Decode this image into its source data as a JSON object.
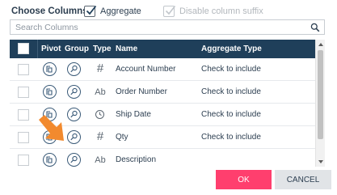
{
  "header": {
    "title": "Choose Columns",
    "aggregate": {
      "label": "Aggregate",
      "checked": true,
      "enabled": true
    },
    "disable_suffix": {
      "label": "Disable column suffix",
      "checked": true,
      "enabled": false
    }
  },
  "search": {
    "placeholder": "Search Columns",
    "value": "",
    "icon": "search-icon"
  },
  "grid": {
    "columns": [
      "Pivot",
      "Group",
      "Type",
      "Name",
      "Aggregate Type"
    ],
    "rows": [
      {
        "type": "#",
        "type_icon": "number-type-icon",
        "name": "Account Number",
        "aggregate": "Check to include"
      },
      {
        "type": "Ab",
        "type_icon": "text-type-icon",
        "name": "Order Number",
        "aggregate": "Check to include"
      },
      {
        "type": "",
        "type_icon": "clock-type-icon",
        "name": "Ship Date",
        "aggregate": "Check to include"
      },
      {
        "type": "#",
        "type_icon": "number-type-icon",
        "name": "Qty",
        "aggregate": "Check to include"
      },
      {
        "type": "Ab",
        "type_icon": "text-type-icon",
        "name": "Description",
        "aggregate": ""
      }
    ]
  },
  "footer": {
    "ok_label": "OK",
    "cancel_label": "CANCEL"
  },
  "colors": {
    "header_bg": "#1f3f5a",
    "ok_bg": "#ff3f6e",
    "cancel_bg": "#e1e4e7",
    "arrow": "#f28a2e"
  }
}
